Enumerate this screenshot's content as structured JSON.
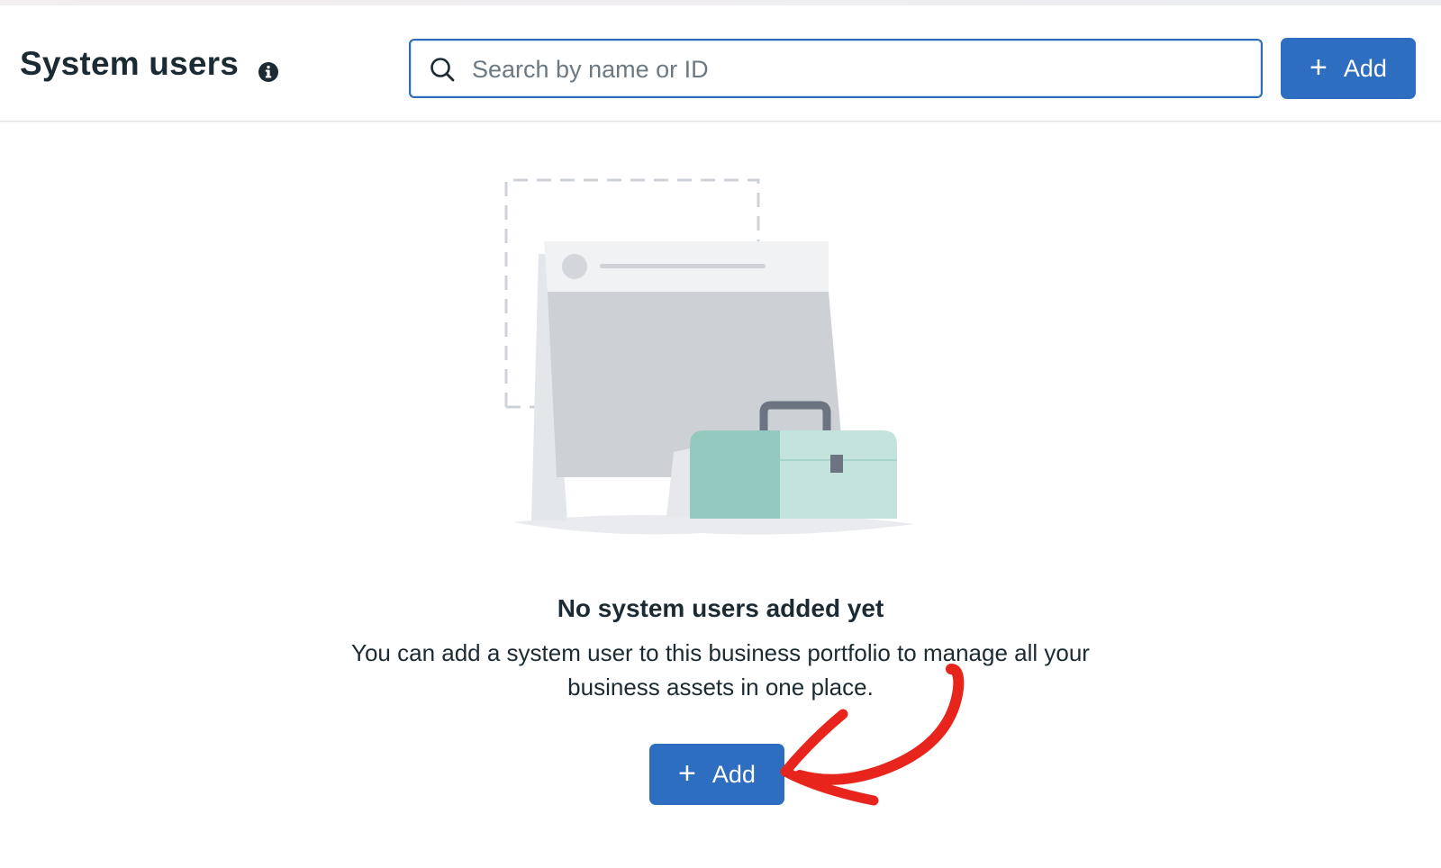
{
  "header": {
    "title": "System users",
    "info_icon": "info-icon",
    "search": {
      "placeholder": "Search by name or ID",
      "value": "",
      "icon": "search-icon"
    },
    "add_button": {
      "icon": "plus-icon",
      "label": "Add"
    }
  },
  "empty_state": {
    "illustration": "empty-portfolio-illustration",
    "title": "No system users added yet",
    "description": "You can add a system user to this business portfolio to manage all your business assets in one place.",
    "add_button": {
      "icon": "plus-icon",
      "label": "Add"
    },
    "annotation": "red-arrow-pointing-to-add"
  },
  "colors": {
    "primary_button": "#2d6ec0",
    "search_border": "#2b6cb8",
    "text": "#1c2b33",
    "placeholder": "#6c7983",
    "annotation_arrow": "#e8251c",
    "briefcase_dark": "#94c9bf",
    "briefcase_light": "#c4e3dc"
  }
}
